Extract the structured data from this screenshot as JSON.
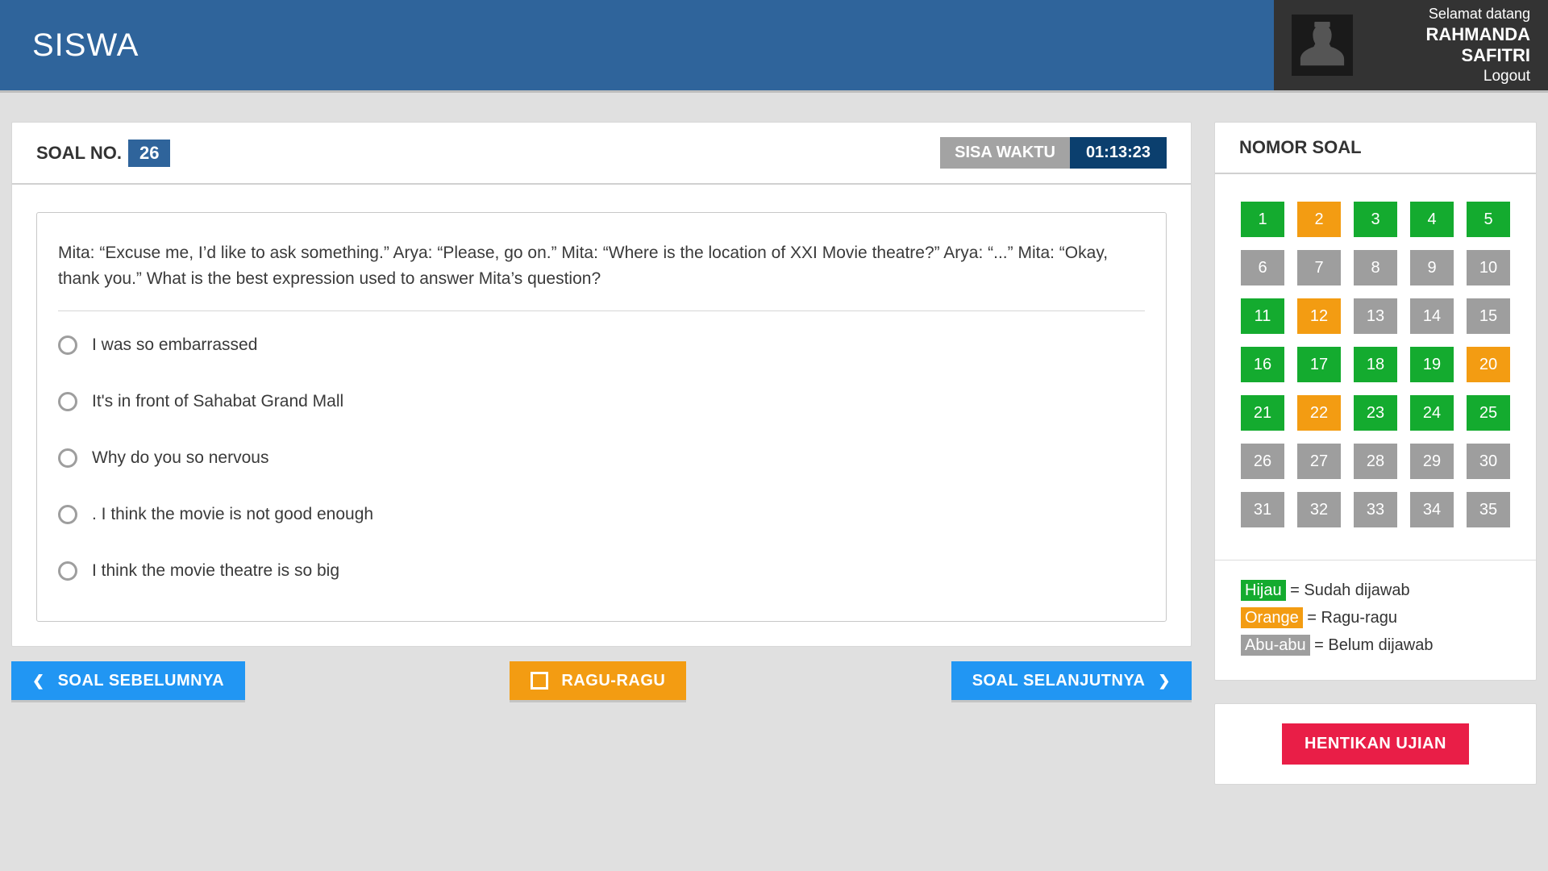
{
  "header": {
    "title": "SISWA",
    "welcome": "Selamat datang",
    "user_name": "RAHMANDA SAFITRI",
    "logout": "Logout"
  },
  "question_panel": {
    "label": "SOAL NO.",
    "number": "26",
    "timer_label": "SISA WAKTU",
    "timer_value": "01:13:23",
    "text": "Mita: “Excuse me, I’d like to ask something.” Arya: “Please, go on.” Mita: “Where is the location of XXI Movie theatre?” Arya: “...” Mita: “Okay, thank you.” What is the best expression used to answer Mita’s question?",
    "options": [
      "I was so embarrassed",
      "It's in front of Sahabat Grand Mall",
      "Why do you so nervous",
      ". I think the movie is not good enough",
      "I think the movie theatre is so big"
    ]
  },
  "nav": {
    "prev": "SOAL SEBELUMNYA",
    "doubt": "RAGU-RAGU",
    "next": "SOAL SELANJUTNYA"
  },
  "sidebar": {
    "title": "NOMOR SOAL",
    "cells": [
      {
        "n": "1",
        "s": "green"
      },
      {
        "n": "2",
        "s": "orange"
      },
      {
        "n": "3",
        "s": "green"
      },
      {
        "n": "4",
        "s": "green"
      },
      {
        "n": "5",
        "s": "green"
      },
      {
        "n": "6",
        "s": "gray"
      },
      {
        "n": "7",
        "s": "gray"
      },
      {
        "n": "8",
        "s": "gray"
      },
      {
        "n": "9",
        "s": "gray"
      },
      {
        "n": "10",
        "s": "gray"
      },
      {
        "n": "11",
        "s": "green"
      },
      {
        "n": "12",
        "s": "orange"
      },
      {
        "n": "13",
        "s": "gray"
      },
      {
        "n": "14",
        "s": "gray"
      },
      {
        "n": "15",
        "s": "gray"
      },
      {
        "n": "16",
        "s": "green"
      },
      {
        "n": "17",
        "s": "green"
      },
      {
        "n": "18",
        "s": "green"
      },
      {
        "n": "19",
        "s": "green"
      },
      {
        "n": "20",
        "s": "orange"
      },
      {
        "n": "21",
        "s": "green"
      },
      {
        "n": "22",
        "s": "orange"
      },
      {
        "n": "23",
        "s": "green"
      },
      {
        "n": "24",
        "s": "green"
      },
      {
        "n": "25",
        "s": "green"
      },
      {
        "n": "26",
        "s": "gray"
      },
      {
        "n": "27",
        "s": "gray"
      },
      {
        "n": "28",
        "s": "gray"
      },
      {
        "n": "29",
        "s": "gray"
      },
      {
        "n": "30",
        "s": "gray"
      },
      {
        "n": "31",
        "s": "gray"
      },
      {
        "n": "32",
        "s": "gray"
      },
      {
        "n": "33",
        "s": "gray"
      },
      {
        "n": "34",
        "s": "gray"
      },
      {
        "n": "35",
        "s": "gray"
      }
    ],
    "legend": {
      "green_tag": "Hijau",
      "green_desc": " = Sudah dijawab",
      "orange_tag": "Orange",
      "orange_desc": " = Ragu-ragu",
      "gray_tag": "Abu-abu",
      "gray_desc": " = Belum dijawab"
    },
    "stop": "HENTIKAN UJIAN"
  }
}
